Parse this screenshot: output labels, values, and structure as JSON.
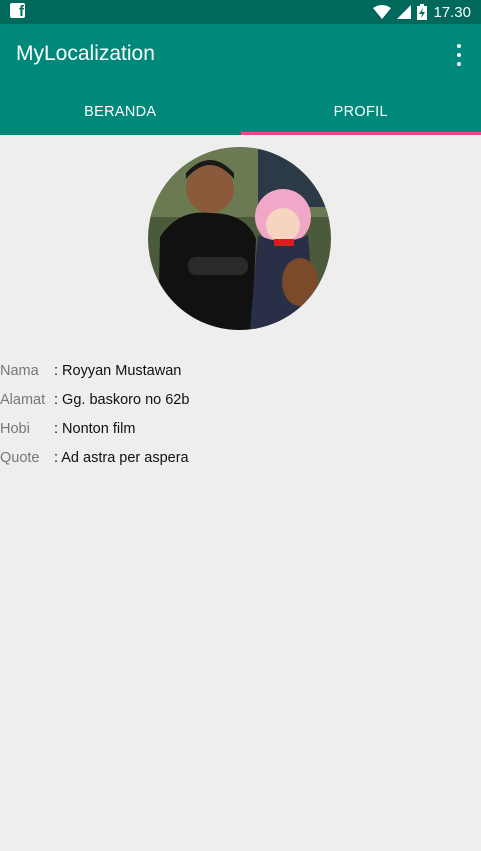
{
  "status_bar": {
    "left_icon": "facebook-icon",
    "time": "17.30",
    "icons": [
      "wifi-icon",
      "signal-icon",
      "battery-charging-icon"
    ]
  },
  "app_bar": {
    "title": "MyLocalization",
    "menu_icon": "overflow-menu-icon"
  },
  "tabs": [
    {
      "label": "BERANDA",
      "active": false
    },
    {
      "label": "PROFIL",
      "active": true
    }
  ],
  "profile": {
    "avatar": "profile-photo",
    "fields": [
      {
        "label": "Nama",
        "value": ": Royyan Mustawan"
      },
      {
        "label": "Alamat",
        "value": ": Gg. baskoro no 62b"
      },
      {
        "label": "Hobi",
        "value": ": Nonton film"
      },
      {
        "label": "Quote",
        "value": ": Ad astra per aspera"
      }
    ]
  },
  "colors": {
    "primary": "#00897b",
    "primary_dark": "#00695c",
    "accent": "#ff4081",
    "background": "#eeeeee"
  }
}
